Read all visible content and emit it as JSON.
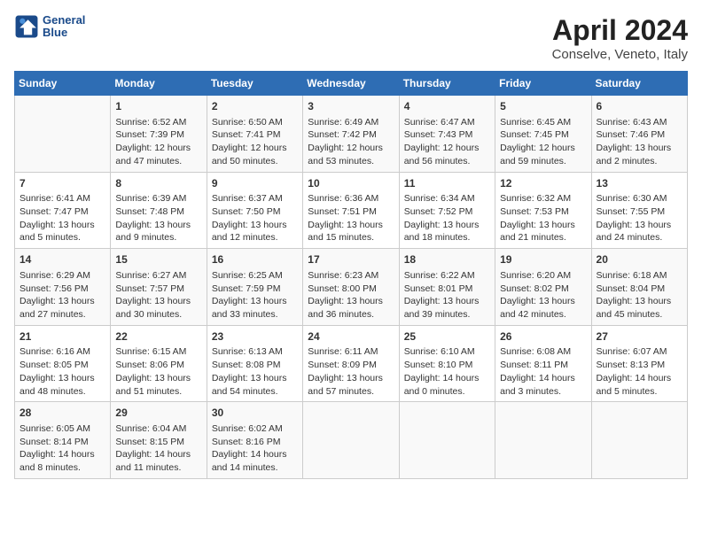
{
  "header": {
    "logo_line1": "General",
    "logo_line2": "Blue",
    "title": "April 2024",
    "subtitle": "Conselve, Veneto, Italy"
  },
  "columns": [
    "Sunday",
    "Monday",
    "Tuesday",
    "Wednesday",
    "Thursday",
    "Friday",
    "Saturday"
  ],
  "weeks": [
    [
      {
        "day": "",
        "content": ""
      },
      {
        "day": "1",
        "content": "Sunrise: 6:52 AM\nSunset: 7:39 PM\nDaylight: 12 hours\nand 47 minutes."
      },
      {
        "day": "2",
        "content": "Sunrise: 6:50 AM\nSunset: 7:41 PM\nDaylight: 12 hours\nand 50 minutes."
      },
      {
        "day": "3",
        "content": "Sunrise: 6:49 AM\nSunset: 7:42 PM\nDaylight: 12 hours\nand 53 minutes."
      },
      {
        "day": "4",
        "content": "Sunrise: 6:47 AM\nSunset: 7:43 PM\nDaylight: 12 hours\nand 56 minutes."
      },
      {
        "day": "5",
        "content": "Sunrise: 6:45 AM\nSunset: 7:45 PM\nDaylight: 12 hours\nand 59 minutes."
      },
      {
        "day": "6",
        "content": "Sunrise: 6:43 AM\nSunset: 7:46 PM\nDaylight: 13 hours\nand 2 minutes."
      }
    ],
    [
      {
        "day": "7",
        "content": "Sunrise: 6:41 AM\nSunset: 7:47 PM\nDaylight: 13 hours\nand 5 minutes."
      },
      {
        "day": "8",
        "content": "Sunrise: 6:39 AM\nSunset: 7:48 PM\nDaylight: 13 hours\nand 9 minutes."
      },
      {
        "day": "9",
        "content": "Sunrise: 6:37 AM\nSunset: 7:50 PM\nDaylight: 13 hours\nand 12 minutes."
      },
      {
        "day": "10",
        "content": "Sunrise: 6:36 AM\nSunset: 7:51 PM\nDaylight: 13 hours\nand 15 minutes."
      },
      {
        "day": "11",
        "content": "Sunrise: 6:34 AM\nSunset: 7:52 PM\nDaylight: 13 hours\nand 18 minutes."
      },
      {
        "day": "12",
        "content": "Sunrise: 6:32 AM\nSunset: 7:53 PM\nDaylight: 13 hours\nand 21 minutes."
      },
      {
        "day": "13",
        "content": "Sunrise: 6:30 AM\nSunset: 7:55 PM\nDaylight: 13 hours\nand 24 minutes."
      }
    ],
    [
      {
        "day": "14",
        "content": "Sunrise: 6:29 AM\nSunset: 7:56 PM\nDaylight: 13 hours\nand 27 minutes."
      },
      {
        "day": "15",
        "content": "Sunrise: 6:27 AM\nSunset: 7:57 PM\nDaylight: 13 hours\nand 30 minutes."
      },
      {
        "day": "16",
        "content": "Sunrise: 6:25 AM\nSunset: 7:59 PM\nDaylight: 13 hours\nand 33 minutes."
      },
      {
        "day": "17",
        "content": "Sunrise: 6:23 AM\nSunset: 8:00 PM\nDaylight: 13 hours\nand 36 minutes."
      },
      {
        "day": "18",
        "content": "Sunrise: 6:22 AM\nSunset: 8:01 PM\nDaylight: 13 hours\nand 39 minutes."
      },
      {
        "day": "19",
        "content": "Sunrise: 6:20 AM\nSunset: 8:02 PM\nDaylight: 13 hours\nand 42 minutes."
      },
      {
        "day": "20",
        "content": "Sunrise: 6:18 AM\nSunset: 8:04 PM\nDaylight: 13 hours\nand 45 minutes."
      }
    ],
    [
      {
        "day": "21",
        "content": "Sunrise: 6:16 AM\nSunset: 8:05 PM\nDaylight: 13 hours\nand 48 minutes."
      },
      {
        "day": "22",
        "content": "Sunrise: 6:15 AM\nSunset: 8:06 PM\nDaylight: 13 hours\nand 51 minutes."
      },
      {
        "day": "23",
        "content": "Sunrise: 6:13 AM\nSunset: 8:08 PM\nDaylight: 13 hours\nand 54 minutes."
      },
      {
        "day": "24",
        "content": "Sunrise: 6:11 AM\nSunset: 8:09 PM\nDaylight: 13 hours\nand 57 minutes."
      },
      {
        "day": "25",
        "content": "Sunrise: 6:10 AM\nSunset: 8:10 PM\nDaylight: 14 hours\nand 0 minutes."
      },
      {
        "day": "26",
        "content": "Sunrise: 6:08 AM\nSunset: 8:11 PM\nDaylight: 14 hours\nand 3 minutes."
      },
      {
        "day": "27",
        "content": "Sunrise: 6:07 AM\nSunset: 8:13 PM\nDaylight: 14 hours\nand 5 minutes."
      }
    ],
    [
      {
        "day": "28",
        "content": "Sunrise: 6:05 AM\nSunset: 8:14 PM\nDaylight: 14 hours\nand 8 minutes."
      },
      {
        "day": "29",
        "content": "Sunrise: 6:04 AM\nSunset: 8:15 PM\nDaylight: 14 hours\nand 11 minutes."
      },
      {
        "day": "30",
        "content": "Sunrise: 6:02 AM\nSunset: 8:16 PM\nDaylight: 14 hours\nand 14 minutes."
      },
      {
        "day": "",
        "content": ""
      },
      {
        "day": "",
        "content": ""
      },
      {
        "day": "",
        "content": ""
      },
      {
        "day": "",
        "content": ""
      }
    ]
  ]
}
